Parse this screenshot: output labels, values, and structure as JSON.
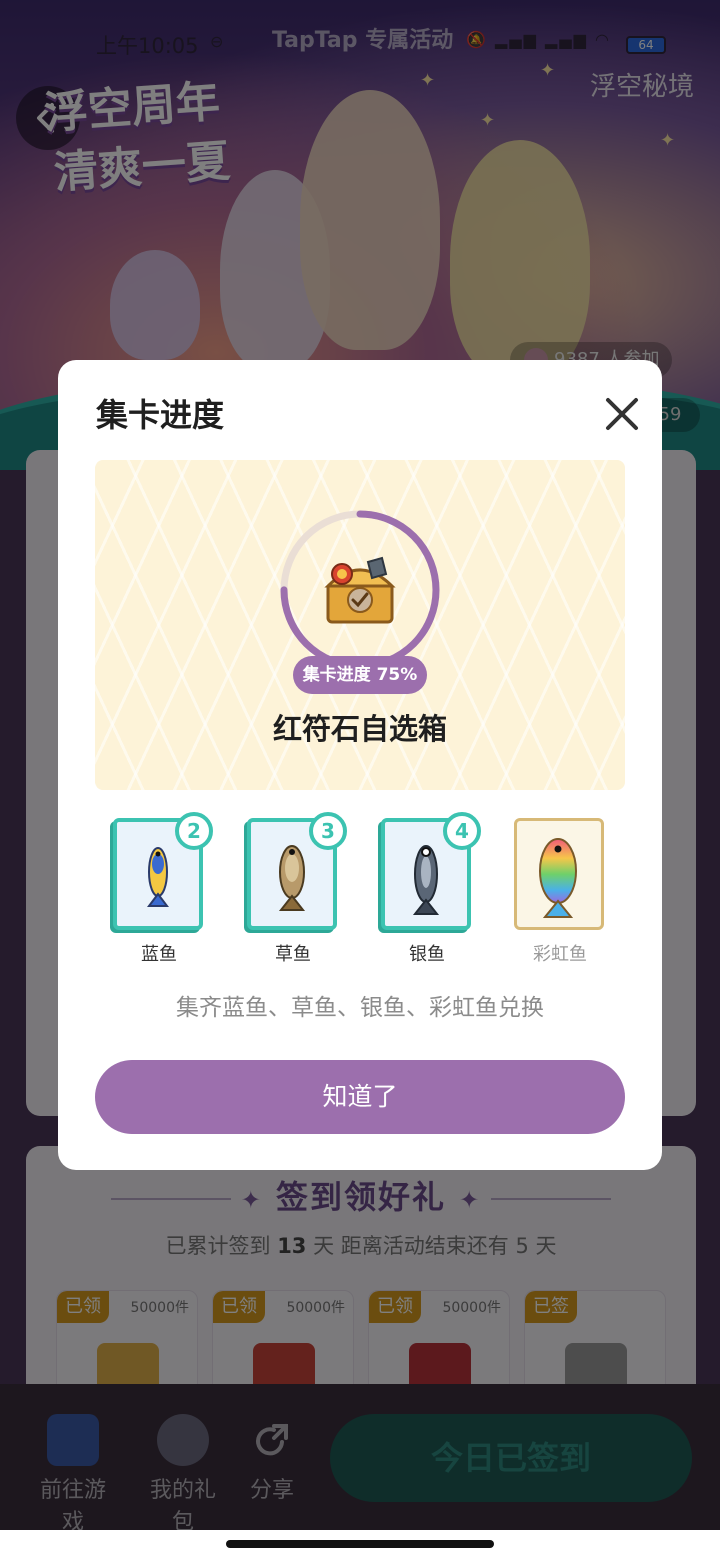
{
  "status_bar": {
    "time": "上午10:05",
    "header_label": "TapTap 专属活动",
    "battery": "64"
  },
  "banner": {
    "title_line1": "浮空周年",
    "title_line2": "清爽一夏",
    "game_logo": "浮空秘境",
    "participants": "9387 人参加",
    "countdown": "59"
  },
  "signin": {
    "title": "签到领好礼",
    "progress_prefix": "已累计签到 ",
    "days": "13",
    "progress_mid": " 天  距离活动结束还有 5 天",
    "rewards": [
      {
        "tag": "已领",
        "qty": "50000件",
        "color": "#e0b04a"
      },
      {
        "tag": "已领",
        "qty": "50000件",
        "color": "#c9453a"
      },
      {
        "tag": "已领",
        "qty": "50000件",
        "color": "#b8323a"
      },
      {
        "tag": "已签",
        "qty": "",
        "color": "#9a9a9a"
      }
    ]
  },
  "bottom_bar": {
    "tab1": "前往游戏",
    "tab2": "我的礼包",
    "tab3": "分享",
    "signed_button": "今日已签到"
  },
  "modal": {
    "title": "集卡进度",
    "progress_label": "集卡进度 75%",
    "progress_value": 0.75,
    "reward_name": "红符石自选箱",
    "cards": [
      {
        "name": "蓝鱼",
        "count": "2",
        "fish_color": "#f4c842",
        "icon": "blue-fish"
      },
      {
        "name": "草鱼",
        "count": "3",
        "fish_color": "#a8875a",
        "icon": "grass-carp"
      },
      {
        "name": "银鱼",
        "count": "4",
        "fish_color": "#4a5566",
        "icon": "silver-fish"
      },
      {
        "name": "彩虹鱼",
        "count": "",
        "fish_color": "#ef5a7a",
        "icon": "rainbow-fish"
      }
    ],
    "description": "集齐蓝鱼、草鱼、银鱼、彩虹鱼兑换",
    "confirm_button": "知道了"
  },
  "colors": {
    "accent_purple": "#9c6fad",
    "card_teal": "#3cc3b1"
  }
}
